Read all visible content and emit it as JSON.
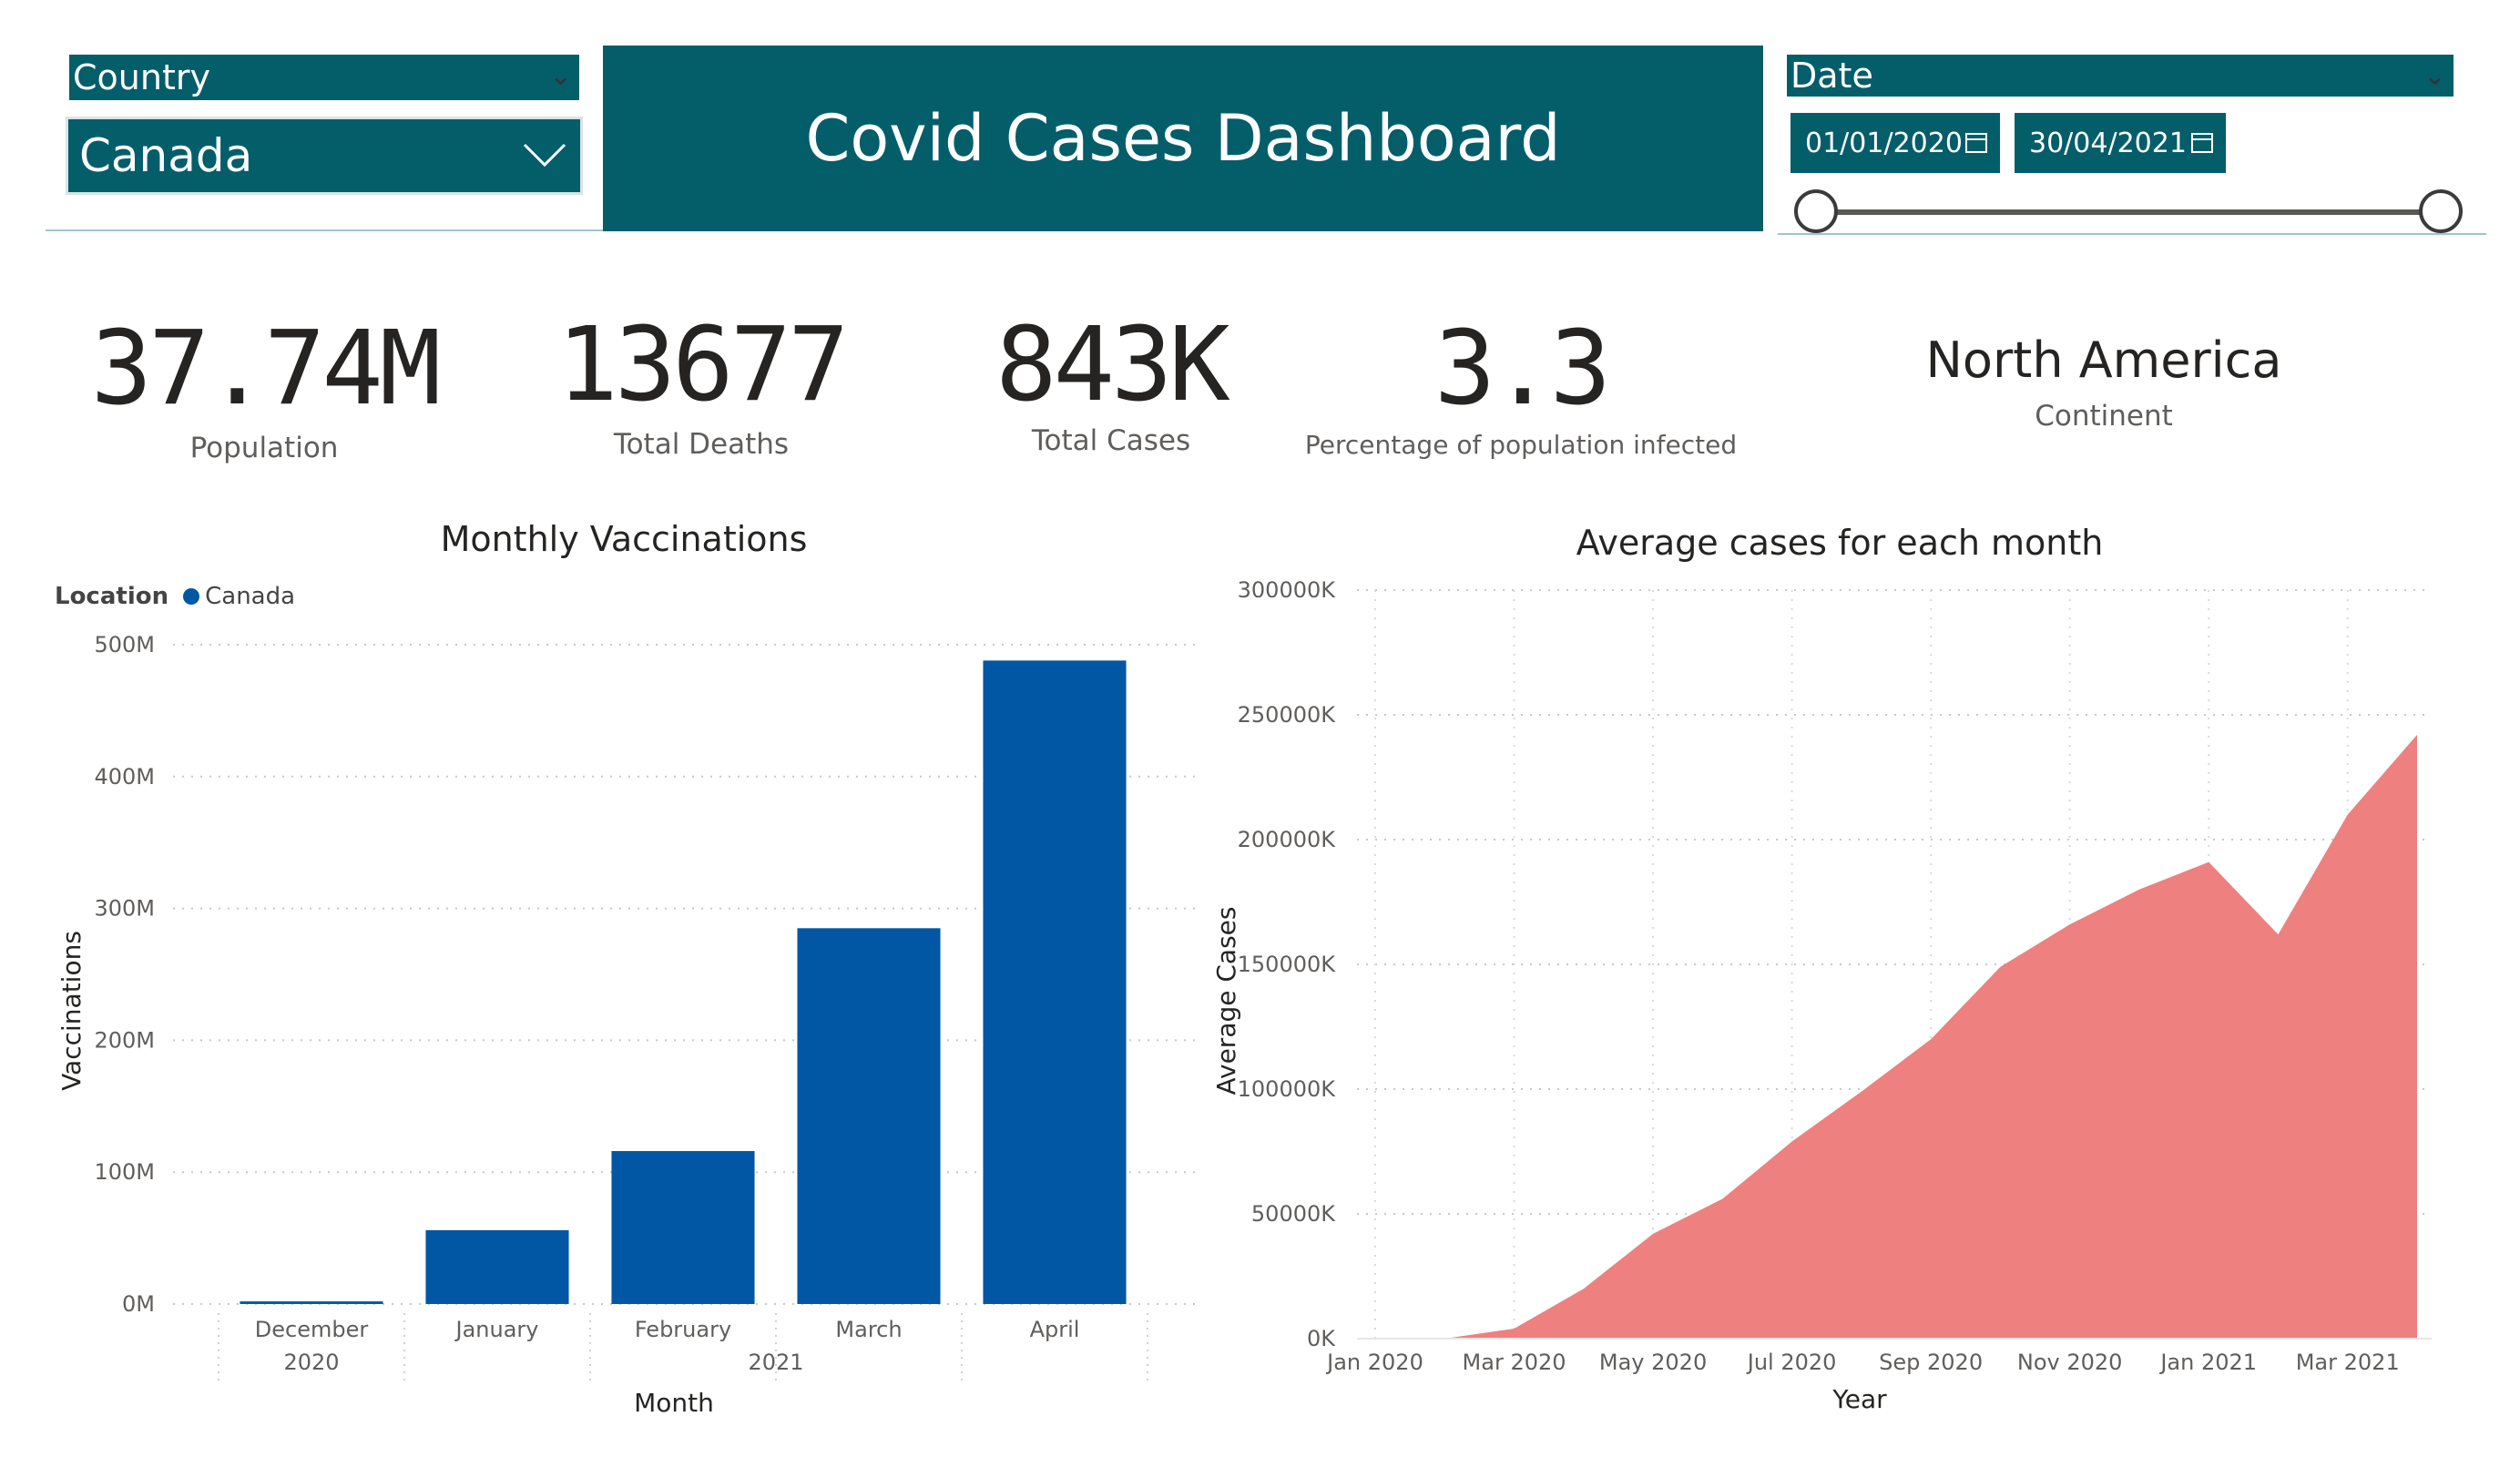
{
  "filters": {
    "country": {
      "label": "Country",
      "value": "Canada"
    },
    "date": {
      "label": "Date",
      "start": "01/01/2020",
      "end": "30/04/2021"
    }
  },
  "header": {
    "title": "Covid Cases Dashboard"
  },
  "kpis": [
    {
      "value": "37.74M",
      "label": "Population"
    },
    {
      "value": "13677",
      "label": "Total Deaths"
    },
    {
      "value": "843K",
      "label": "Total Cases"
    },
    {
      "value": "3.3",
      "label": "Percentage of population infected"
    },
    {
      "value": "North America",
      "label": "Continent"
    }
  ],
  "colors": {
    "brand": "#035e6a",
    "bar": "#0257a4",
    "area": "#ee8080"
  },
  "chart_data": [
    {
      "type": "bar",
      "title": "Monthly Vaccinations",
      "legend": {
        "title": "Location",
        "entries": [
          "Canada"
        ],
        "position": "top-left"
      },
      "categories": [
        "December",
        "January",
        "February",
        "March",
        "April"
      ],
      "category_years": [
        "2020",
        "2021",
        "2021",
        "2021",
        "2021"
      ],
      "year_labels": [
        "2020",
        "2021"
      ],
      "series": [
        {
          "name": "Canada",
          "values": [
            2,
            56,
            116,
            285,
            488
          ]
        }
      ],
      "value_unit": "M",
      "xlabel": "Month",
      "ylabel": "Vaccinations",
      "ylim": [
        0,
        500
      ],
      "yticks": [
        "0M",
        "100M",
        "200M",
        "300M",
        "400M",
        "500M"
      ],
      "grid": true
    },
    {
      "type": "area",
      "title": "Average cases for each month",
      "x": [
        "Jan 2020",
        "Feb 2020",
        "Mar 2020",
        "Apr 2020",
        "May 2020",
        "Jun 2020",
        "Jul 2020",
        "Aug 2020",
        "Sep 2020",
        "Oct 2020",
        "Nov 2020",
        "Dec 2020",
        "Jan 2021",
        "Feb 2021",
        "Mar 2021",
        "Apr 2021"
      ],
      "values": [
        0,
        0,
        4000,
        20000,
        42000,
        56000,
        79000,
        99000,
        120000,
        149000,
        166000,
        180000,
        191000,
        162000,
        210000,
        242000
      ],
      "value_unit": "K",
      "xticks": [
        "Jan 2020",
        "Mar 2020",
        "May 2020",
        "Jul 2020",
        "Sep 2020",
        "Nov 2020",
        "Jan 2021",
        "Mar 2021"
      ],
      "xlabel": "Year",
      "ylabel": "Average Cases",
      "ylim": [
        0,
        300000
      ],
      "yticks": [
        "0K",
        "50000K",
        "100000K",
        "150000K",
        "200000K",
        "250000K",
        "300000K"
      ],
      "grid": true
    }
  ]
}
